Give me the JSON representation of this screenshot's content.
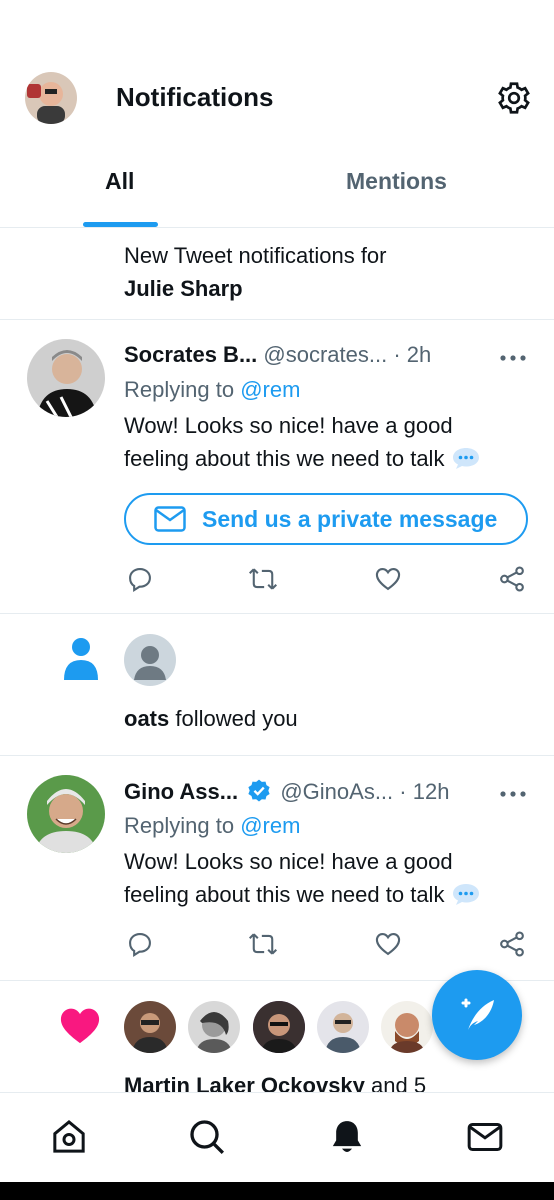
{
  "header": {
    "title": "Notifications"
  },
  "tabs": [
    {
      "label": "All",
      "active": true
    },
    {
      "label": "Mentions",
      "active": false
    }
  ],
  "tweet_notification": {
    "prefix": "New Tweet notifications for",
    "name": "Julie Sharp"
  },
  "tweets": [
    {
      "name": "Socrates B...",
      "handle": "@socrates...",
      "time": "· 2h",
      "verified": false,
      "replying_prefix": "Replying to ",
      "replying_to": "@rem",
      "body": "Wow! Looks so nice! have a good feeling about this we need to talk",
      "dm_button_label": "Send us a private message"
    },
    {
      "name": "Gino Ass...",
      "handle": "@GinoAs...",
      "time": "· 12h",
      "verified": true,
      "replying_prefix": "Replying to ",
      "replying_to": "@rem",
      "body": "Wow! Looks so nice! have a good feeling about this we need to talk"
    }
  ],
  "follow_notification": {
    "name": "oats",
    "text": " followed you"
  },
  "like_notification": {
    "names": "Martin Laker Ockovsky",
    "text": " and 5"
  },
  "colors": {
    "accent": "#1d9bf0",
    "like": "#f91880",
    "text": "#0f1419",
    "muted": "#536471"
  },
  "icons": {
    "settings": "gear-icon",
    "compose": "compose-tweet-icon",
    "nav": [
      "home-icon",
      "search-icon",
      "bell-icon",
      "mail-icon"
    ]
  }
}
